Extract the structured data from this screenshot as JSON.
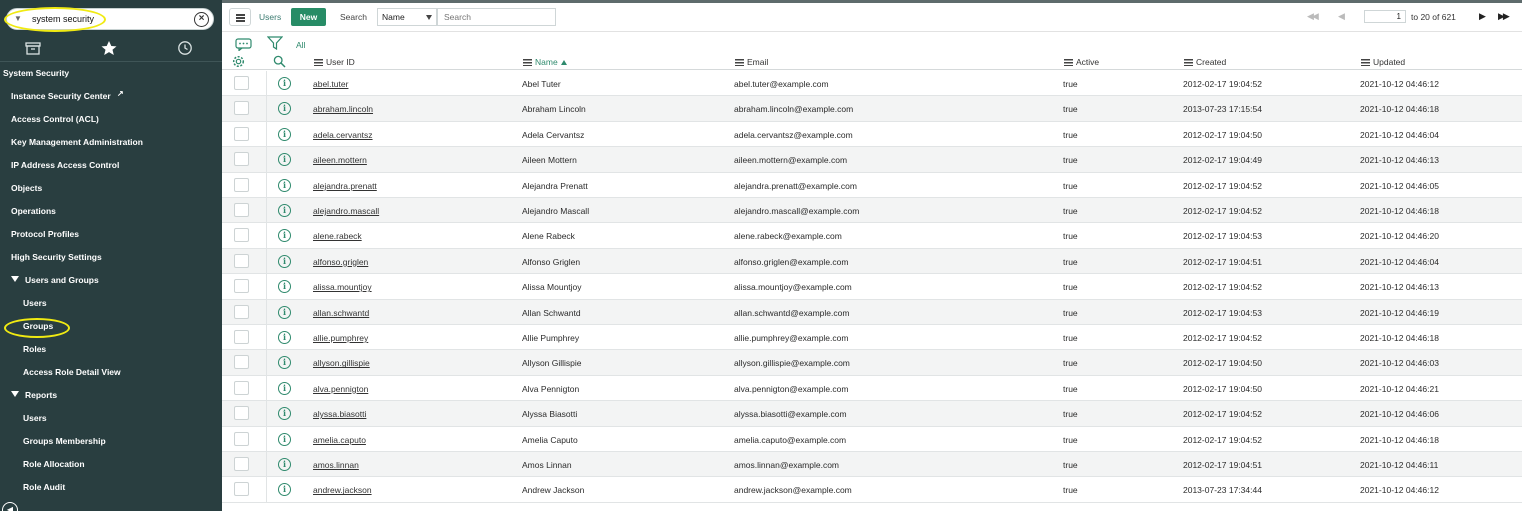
{
  "sidebar": {
    "filter_value": "system security",
    "tabs": [
      "all-applications",
      "favorites",
      "history"
    ],
    "items": [
      {
        "label": "System Security",
        "level": 0
      },
      {
        "label": "Instance Security Center",
        "level": 1,
        "external": true
      },
      {
        "label": "Access Control (ACL)",
        "level": 1
      },
      {
        "label": "Key Management Administration",
        "level": 1
      },
      {
        "label": "IP Address Access Control",
        "level": 1
      },
      {
        "label": "Objects",
        "level": 1
      },
      {
        "label": "Operations",
        "level": 1
      },
      {
        "label": "Protocol Profiles",
        "level": 1
      },
      {
        "label": "High Security Settings",
        "level": 1
      },
      {
        "label": "Users and Groups",
        "level": 1,
        "expanded": true
      },
      {
        "label": "Users",
        "level": 2
      },
      {
        "label": "Groups",
        "level": 2,
        "highlighted": true
      },
      {
        "label": "Roles",
        "level": 2
      },
      {
        "label": "Access Role Detail View",
        "level": 2
      },
      {
        "label": "Reports",
        "level": 1,
        "expanded": true
      },
      {
        "label": "Users",
        "level": 2
      },
      {
        "label": "Groups Membership",
        "level": 2
      },
      {
        "label": "Role Allocation",
        "level": 2
      },
      {
        "label": "Role Audit",
        "level": 2
      }
    ]
  },
  "header": {
    "list_title": "Users",
    "new_label": "New",
    "search_label": "Search",
    "search_field": "Name",
    "search_placeholder": "Search",
    "page": "1",
    "range_text": "to 20 of 621"
  },
  "tools": {
    "all_label": "All"
  },
  "columns": {
    "user_id": "User ID",
    "name": "Name",
    "email": "Email",
    "active": "Active",
    "created": "Created",
    "updated": "Updated"
  },
  "sort": {
    "column": "Name",
    "direction": "ascending"
  },
  "rows": [
    {
      "user_id": "abel.tuter",
      "name": "Abel Tuter",
      "email": "abel.tuter@example.com",
      "active": "true",
      "created": "2012-02-17 19:04:52",
      "updated": "2021-10-12 04:46:12"
    },
    {
      "user_id": "abraham.lincoln",
      "name": "Abraham Lincoln",
      "email": "abraham.lincoln@example.com",
      "active": "true",
      "created": "2013-07-23 17:15:54",
      "updated": "2021-10-12 04:46:18"
    },
    {
      "user_id": "adela.cervantsz",
      "name": "Adela Cervantsz",
      "email": "adela.cervantsz@example.com",
      "active": "true",
      "created": "2012-02-17 19:04:50",
      "updated": "2021-10-12 04:46:04"
    },
    {
      "user_id": "aileen.mottern",
      "name": "Aileen Mottern",
      "email": "aileen.mottern@example.com",
      "active": "true",
      "created": "2012-02-17 19:04:49",
      "updated": "2021-10-12 04:46:13"
    },
    {
      "user_id": "alejandra.prenatt",
      "name": "Alejandra Prenatt",
      "email": "alejandra.prenatt@example.com",
      "active": "true",
      "created": "2012-02-17 19:04:52",
      "updated": "2021-10-12 04:46:05"
    },
    {
      "user_id": "alejandro.mascall",
      "name": "Alejandro Mascall",
      "email": "alejandro.mascall@example.com",
      "active": "true",
      "created": "2012-02-17 19:04:52",
      "updated": "2021-10-12 04:46:18"
    },
    {
      "user_id": "alene.rabeck",
      "name": "Alene Rabeck",
      "email": "alene.rabeck@example.com",
      "active": "true",
      "created": "2012-02-17 19:04:53",
      "updated": "2021-10-12 04:46:20"
    },
    {
      "user_id": "alfonso.griglen",
      "name": "Alfonso Griglen",
      "email": "alfonso.griglen@example.com",
      "active": "true",
      "created": "2012-02-17 19:04:51",
      "updated": "2021-10-12 04:46:04"
    },
    {
      "user_id": "alissa.mountjoy",
      "name": "Alissa Mountjoy",
      "email": "alissa.mountjoy@example.com",
      "active": "true",
      "created": "2012-02-17 19:04:52",
      "updated": "2021-10-12 04:46:13"
    },
    {
      "user_id": "allan.schwantd",
      "name": "Allan Schwantd",
      "email": "allan.schwantd@example.com",
      "active": "true",
      "created": "2012-02-17 19:04:53",
      "updated": "2021-10-12 04:46:19"
    },
    {
      "user_id": "allie.pumphrey",
      "name": "Allie Pumphrey",
      "email": "allie.pumphrey@example.com",
      "active": "true",
      "created": "2012-02-17 19:04:52",
      "updated": "2021-10-12 04:46:18"
    },
    {
      "user_id": "allyson.gillispie",
      "name": "Allyson Gillispie",
      "email": "allyson.gillispie@example.com",
      "active": "true",
      "created": "2012-02-17 19:04:50",
      "updated": "2021-10-12 04:46:03"
    },
    {
      "user_id": "alva.pennigton",
      "name": "Alva Pennigton",
      "email": "alva.pennigton@example.com",
      "active": "true",
      "created": "2012-02-17 19:04:50",
      "updated": "2021-10-12 04:46:21"
    },
    {
      "user_id": "alyssa.biasotti",
      "name": "Alyssa Biasotti",
      "email": "alyssa.biasotti@example.com",
      "active": "true",
      "created": "2012-02-17 19:04:52",
      "updated": "2021-10-12 04:46:06"
    },
    {
      "user_id": "amelia.caputo",
      "name": "Amelia Caputo",
      "email": "amelia.caputo@example.com",
      "active": "true",
      "created": "2012-02-17 19:04:52",
      "updated": "2021-10-12 04:46:18"
    },
    {
      "user_id": "amos.linnan",
      "name": "Amos Linnan",
      "email": "amos.linnan@example.com",
      "active": "true",
      "created": "2012-02-17 19:04:51",
      "updated": "2021-10-12 04:46:11"
    },
    {
      "user_id": "andrew.jackson",
      "name": "Andrew Jackson",
      "email": "andrew.jackson@example.com",
      "active": "true",
      "created": "2013-07-23 17:34:44",
      "updated": "2021-10-12 04:46:12"
    }
  ],
  "colors": {
    "sidebar_bg": "#293e40",
    "accent": "#278c66",
    "link": "#2f8a6d",
    "highlight": "#f0ea12"
  }
}
